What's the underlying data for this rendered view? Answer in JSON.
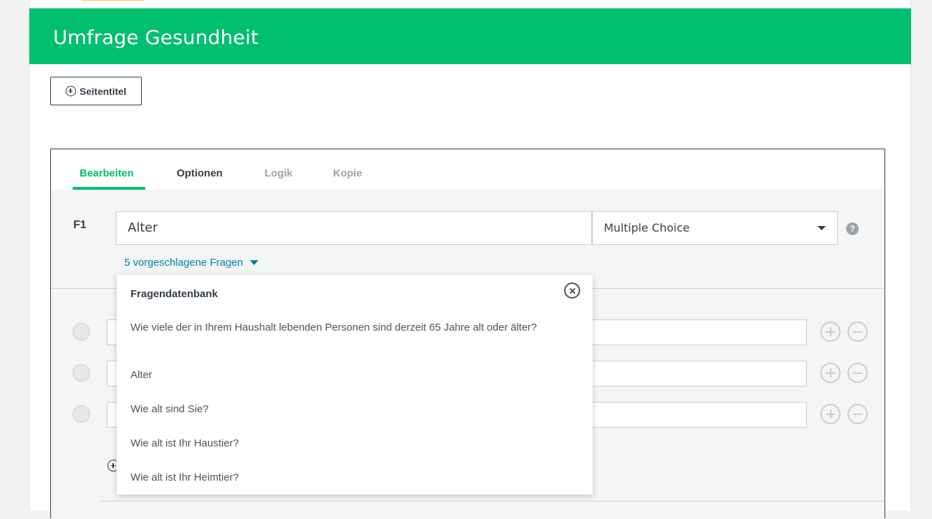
{
  "survey": {
    "title": "Umfrage Gesundheit",
    "page_title_button": "Seitentitel"
  },
  "tabs": [
    {
      "label": "Bearbeiten",
      "state": "active"
    },
    {
      "label": "Optionen",
      "state": "normal"
    },
    {
      "label": "Logik",
      "state": "muted"
    },
    {
      "label": "Kopie",
      "state": "muted"
    }
  ],
  "question": {
    "number": "F1",
    "text": "Alter",
    "type": "Multiple Choice",
    "help_icon": "?",
    "suggestions_link": "5 vorgeschlagene Fragen"
  },
  "dropdown": {
    "title": "Fragendatenbank",
    "items": [
      "Wie viele der in Ihrem Haushalt lebenden Personen sind derzeit 65 Jahre alt oder älter?",
      "Alter",
      "Wie alt sind Sie?",
      "Wie alt ist Ihr Haustier?",
      "Wie alt ist Ihr Heimtier?"
    ]
  },
  "colors": {
    "brand_green": "#00bf6f",
    "link_blue": "#007faa",
    "text_dark": "#333e48"
  }
}
